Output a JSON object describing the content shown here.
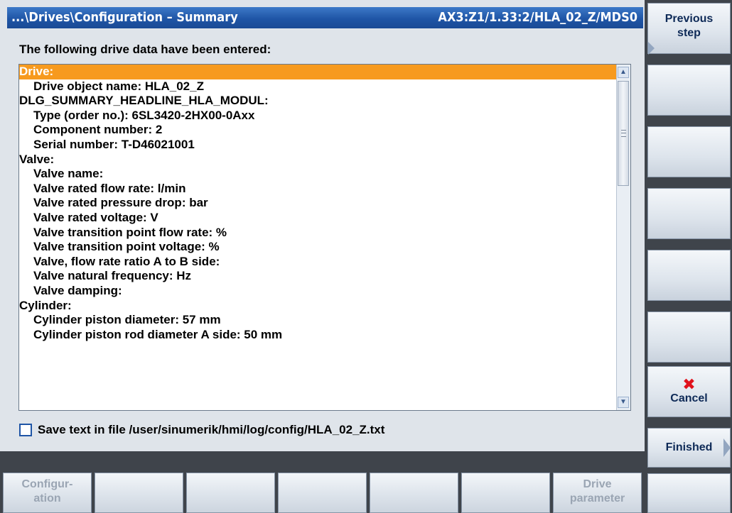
{
  "titlebar": {
    "path": "...\\Drives\\Configuration – Summary",
    "object": "AX3:Z1/1.33:2/HLA_02_Z/MDS0"
  },
  "subtitle": "The following drive data have been entered:",
  "list": [
    {
      "text": "Drive:",
      "indent": false,
      "selected": true
    },
    {
      "text": "Drive object name: HLA_02_Z",
      "indent": true
    },
    {
      "text": "DLG_SUMMARY_HEADLINE_HLA_MODUL:",
      "indent": false
    },
    {
      "text": "Type (order no.): 6SL3420-2HX00-0Axx",
      "indent": true
    },
    {
      "text": "Component number: 2",
      "indent": true
    },
    {
      "text": "Serial number: T-D46021001",
      "indent": true
    },
    {
      "text": "Valve:",
      "indent": false
    },
    {
      "text": "Valve name:",
      "indent": true
    },
    {
      "text": "Valve rated flow rate: l/min",
      "indent": true
    },
    {
      "text": "Valve rated pressure drop: bar",
      "indent": true
    },
    {
      "text": "Valve rated voltage: V",
      "indent": true
    },
    {
      "text": "Valve transition point flow rate: %",
      "indent": true
    },
    {
      "text": "Valve transition point voltage: %",
      "indent": true
    },
    {
      "text": "Valve, flow rate ratio A to B side:",
      "indent": true
    },
    {
      "text": "Valve natural frequency: Hz",
      "indent": true
    },
    {
      "text": "Valve damping:",
      "indent": true
    },
    {
      "text": "Cylinder:",
      "indent": false
    },
    {
      "text": "Cylinder piston diameter: 57 mm",
      "indent": true
    },
    {
      "text": "Cylinder piston rod diameter A side: 50 mm",
      "indent": true
    }
  ],
  "save_checkbox": {
    "label": "Save text in file /user/sinumerik/hmi/log/config/HLA_02_Z.txt",
    "checked": false
  },
  "vertical_softkeys": {
    "previous_step": "Previous\nstep",
    "cancel": "Cancel",
    "finished": "Finished"
  },
  "horizontal_softkeys": {
    "configuration": "Configur-\nation",
    "drive_parameter": "Drive\nparameter"
  },
  "colors": {
    "title_bar": "#1f55a6",
    "selection": "#f79a1e",
    "cancel_icon": "#e0111b"
  }
}
